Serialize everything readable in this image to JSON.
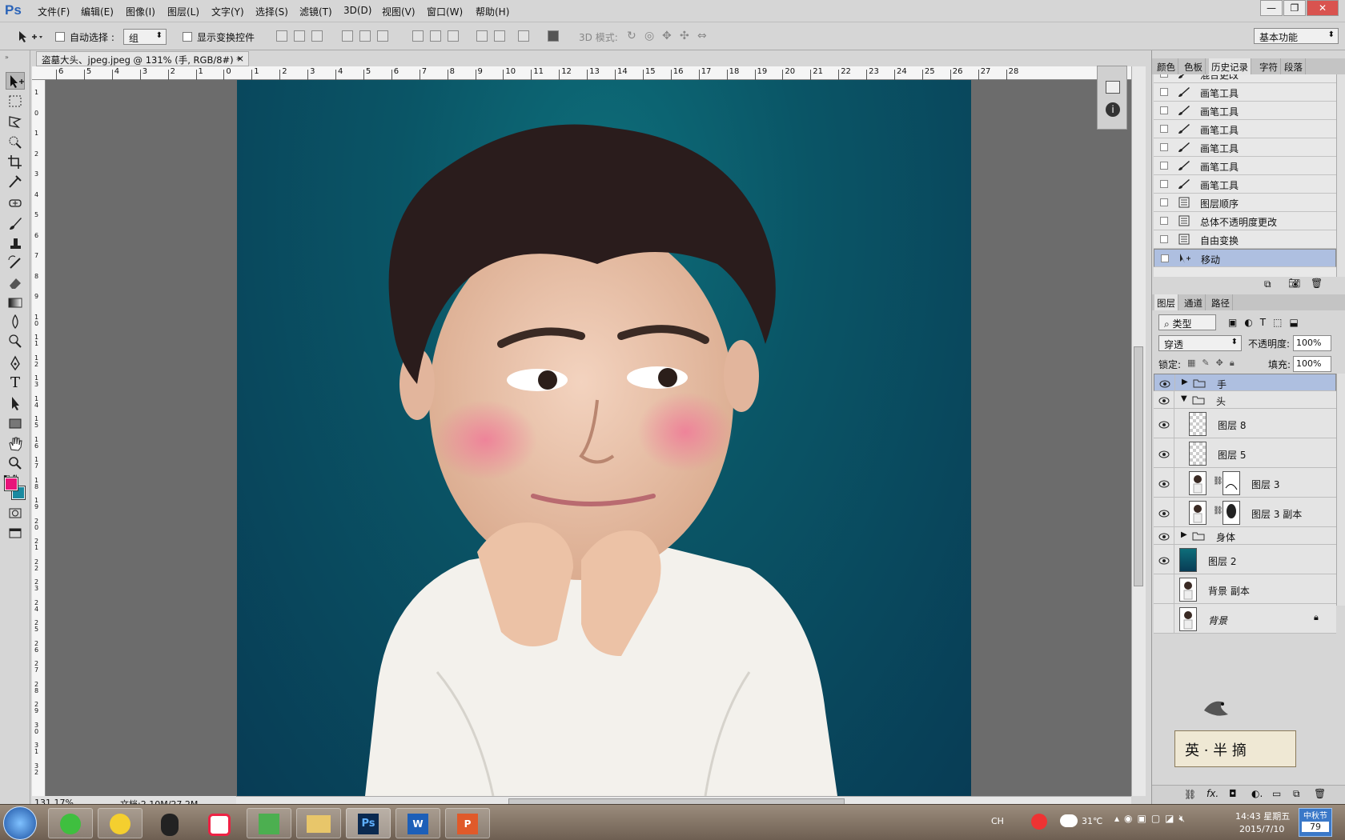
{
  "app": {
    "logo": "Ps"
  },
  "menu": [
    "文件(F)",
    "编辑(E)",
    "图像(I)",
    "图层(L)",
    "文字(Y)",
    "选择(S)",
    "滤镜(T)",
    "3D(D)",
    "视图(V)",
    "窗口(W)",
    "帮助(H)"
  ],
  "window_controls": {
    "minimize": "—",
    "restore": "❐",
    "close": "✕"
  },
  "options": {
    "auto_select_label": "自动选择 :",
    "auto_select_value": "组",
    "show_transform_label": "显示变换控件",
    "mode3d_label": "3D 模式:",
    "workspace": "基本功能"
  },
  "document": {
    "tab_title": "盗墓大头、jpeg.jpeg @ 131% (手, RGB/8#) *",
    "close": "×"
  },
  "rulers": {
    "top": [
      "6",
      "5",
      "4",
      "3",
      "2",
      "1",
      "0",
      "1",
      "2",
      "3",
      "4",
      "5",
      "6",
      "7",
      "8",
      "9",
      "10",
      "11",
      "12",
      "13",
      "14",
      "15",
      "16",
      "17",
      "18",
      "19",
      "20",
      "21",
      "22",
      "23",
      "24",
      "25",
      "26",
      "27",
      "28"
    ],
    "left": [
      "1",
      "0",
      "1",
      "2",
      "3",
      "4",
      "5",
      "6",
      "7",
      "8",
      "9",
      "1 0",
      "1 1",
      "1 2",
      "1 3",
      "1 4",
      "1 5",
      "1 6",
      "1 7",
      "1 8",
      "1 9",
      "2 0",
      "2 1",
      "2 2",
      "2 3",
      "2 4",
      "2 5",
      "2 6",
      "2 7",
      "2 8",
      "2 9",
      "3 0",
      "3 1",
      "3 2"
    ]
  },
  "status": {
    "zoom": "131.17%",
    "doc_size": "文档:2.10M/27.2M"
  },
  "colors": {
    "foreground": "#e8147a",
    "background": "#1a8aa0"
  },
  "panels": {
    "top_tabs": [
      "颜色",
      "色板",
      "历史记录",
      "字符",
      "段落"
    ],
    "history": [
      {
        "icon": "brush-icon",
        "label": "混合更改"
      },
      {
        "icon": "brush-icon",
        "label": "画笔工具"
      },
      {
        "icon": "brush-icon",
        "label": "画笔工具"
      },
      {
        "icon": "brush-icon",
        "label": "画笔工具"
      },
      {
        "icon": "brush-icon",
        "label": "画笔工具"
      },
      {
        "icon": "brush-icon",
        "label": "画笔工具"
      },
      {
        "icon": "brush-icon",
        "label": "画笔工具"
      },
      {
        "icon": "doc-icon",
        "label": "图层顺序"
      },
      {
        "icon": "doc-icon",
        "label": "总体不透明度更改"
      },
      {
        "icon": "doc-icon",
        "label": "自由变换"
      },
      {
        "icon": "move-icon",
        "label": "移动"
      }
    ],
    "layers_tabs": [
      "图层",
      "通道",
      "路径"
    ],
    "filter_kind": "类型",
    "blend_mode": "穿透",
    "opacity_label": "不透明度:",
    "opacity_value": "100%",
    "lock_label": "锁定:",
    "fill_label": "填充:",
    "fill_value": "100%",
    "layers": [
      {
        "name": "手",
        "type": "group",
        "expanded": false
      },
      {
        "name": "头",
        "type": "group",
        "expanded": true
      },
      {
        "name": "图层 8",
        "type": "layer"
      },
      {
        "name": "图层 5",
        "type": "layer"
      },
      {
        "name": "图层 3",
        "type": "layer-mask"
      },
      {
        "name": "图层 3 副本",
        "type": "layer-mask"
      },
      {
        "name": "身体",
        "type": "group",
        "expanded": false
      },
      {
        "name": "图层 2",
        "type": "layer"
      },
      {
        "name": "背景 副本",
        "type": "layer"
      },
      {
        "name": "背景",
        "type": "layer"
      }
    ]
  },
  "watermark": "英 · 半 摘",
  "taskbar": {
    "tray_ime": "CH",
    "temperature": "31℃",
    "time": "14:43 星期五",
    "date": "2015/7/10",
    "festival": "中秋节",
    "festival_days": "79"
  }
}
